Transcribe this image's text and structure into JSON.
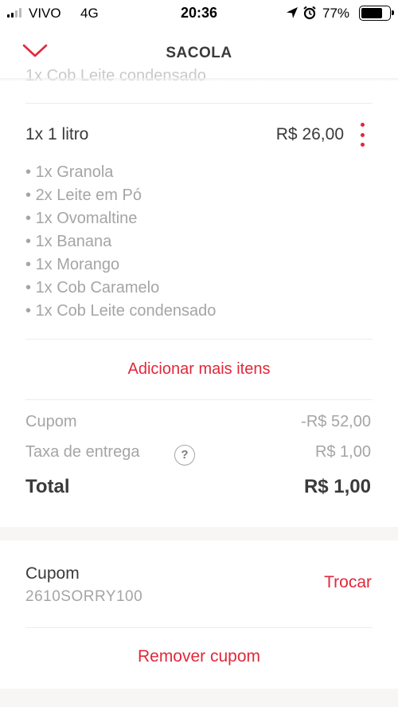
{
  "status_bar": {
    "carrier": "VIVO",
    "network": "4G",
    "time": "20:36",
    "battery_pct": "77%",
    "battery_level": 0.77
  },
  "header": {
    "title": "SACOLA",
    "accent_color": "#e2283a"
  },
  "cut_item_text": "1x Cob Leite condensado",
  "item": {
    "title": "1x 1 litro",
    "price": "R$  26,00",
    "addons": [
      "1x Granola",
      "2x Leite em Pó",
      "1x Ovomaltine",
      "1x Banana",
      "1x Morango",
      "1x Cob Caramelo",
      "1x Cob Leite condensado"
    ]
  },
  "add_more_label": "Adicionar mais itens",
  "summary": {
    "coupon_label": "Cupom",
    "coupon_value": "-R$  52,00",
    "delivery_label": "Taxa de entrega",
    "help_symbol": "?",
    "delivery_value": "R$  1,00",
    "total_label": "Total",
    "total_value": "R$  1,00"
  },
  "coupon": {
    "title": "Cupom",
    "code": "2610SORRY100",
    "swap_label": "Trocar",
    "remove_label": "Remover cupom"
  }
}
